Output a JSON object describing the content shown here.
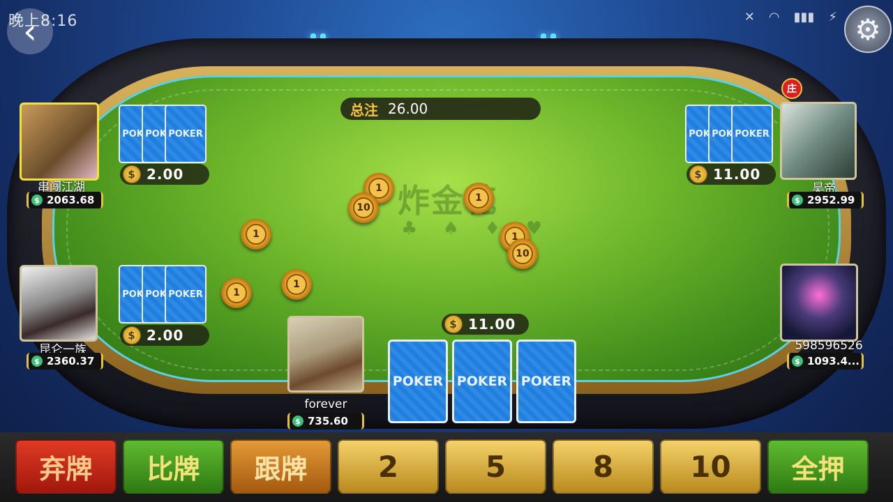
{
  "status_bar": {
    "time": "晚上8:16"
  },
  "icons": {
    "back": "back-arrow-icon",
    "settings": "gear-icon"
  },
  "table": {
    "watermark": "炸金花",
    "suits": "♣ ♠ ♦ ♥"
  },
  "pot": {
    "label": "总注",
    "value": "26.00"
  },
  "dealer_badge": "庄",
  "players": [
    {
      "seat": "top-left",
      "name": "串闯江湖",
      "balance": "2063.68",
      "bet": "2.00",
      "cards": [
        "POKER",
        "POKER",
        "POKER"
      ]
    },
    {
      "seat": "bottom-left",
      "name": "昆仑一族",
      "balance": "2360.37",
      "bet": "2.00",
      "cards": [
        "POKER",
        "POKER",
        "POKER"
      ]
    },
    {
      "seat": "top-right",
      "name": "昊帝",
      "balance": "2952.99",
      "bet": "11.00",
      "cards": [
        "POKER",
        "POKER",
        "POKER"
      ],
      "dealer": true
    },
    {
      "seat": "bottom-right",
      "name": "598596526",
      "balance": "1093.4...",
      "bet": null
    },
    {
      "seat": "self",
      "name": "forever",
      "balance": "735.60",
      "bet": "11.00",
      "cards": [
        "POKER",
        "POKER",
        "POKER"
      ]
    }
  ],
  "chips": [
    "1",
    "10",
    "1",
    "1",
    "1",
    "10",
    "1",
    "1"
  ],
  "actions": {
    "fold": "弃牌",
    "compare": "比牌",
    "call": "跟牌",
    "raise": [
      "2",
      "5",
      "8",
      "10"
    ],
    "all_in": "全押"
  },
  "colors": {
    "felt": "#6cb52a",
    "rim_gold": "#d8b25a",
    "chip": "#e9aa2c",
    "card_back": "#1e7fe0"
  }
}
